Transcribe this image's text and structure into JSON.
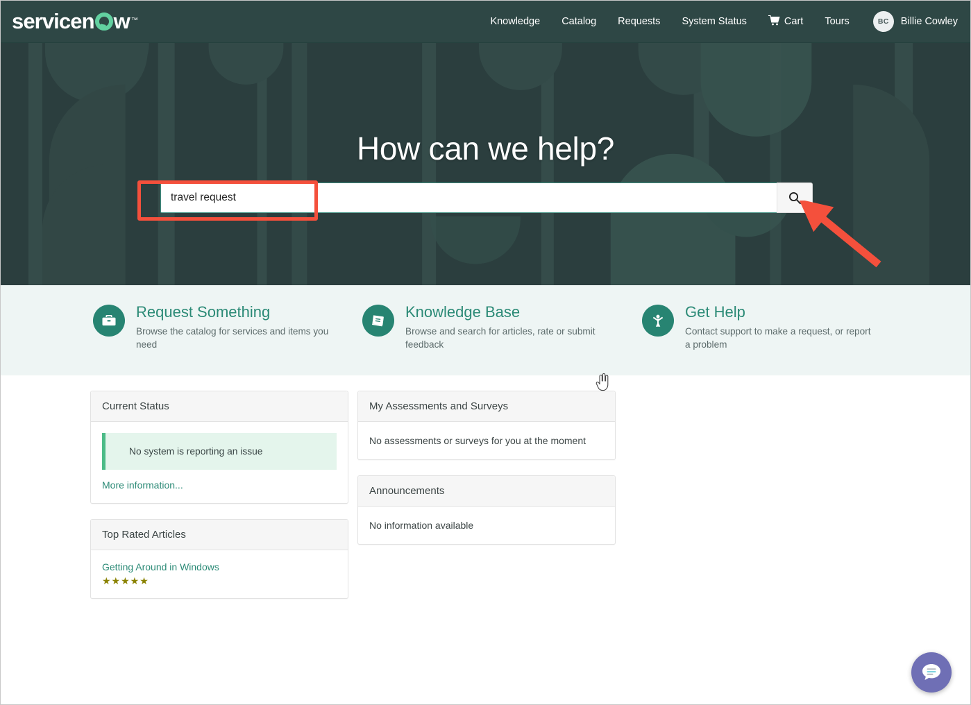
{
  "header": {
    "logo_text_1": "servicen",
    "logo_text_2": "w",
    "logo_tm": "™",
    "nav": [
      {
        "label": "Knowledge"
      },
      {
        "label": "Catalog"
      },
      {
        "label": "Requests"
      },
      {
        "label": "System Status"
      },
      {
        "label": "Cart",
        "icon": "cart-icon"
      },
      {
        "label": "Tours"
      }
    ],
    "user": {
      "initials": "BC",
      "name": "Billie Cowley"
    }
  },
  "hero": {
    "title": "How can we help?",
    "search": {
      "value": "travel request",
      "placeholder": "",
      "button_icon": "search-icon"
    }
  },
  "quicklinks": [
    {
      "icon": "briefcase-icon",
      "title": "Request Something",
      "desc": "Browse the catalog for services and items you need"
    },
    {
      "icon": "book-icon",
      "title": "Knowledge Base",
      "desc": "Browse and search for articles, rate or submit feedback"
    },
    {
      "icon": "person-help-icon",
      "title": "Get Help",
      "desc": "Contact support to make a request, or report a problem"
    }
  ],
  "cards": {
    "current_status": {
      "title": "Current Status",
      "alert_text": "No system is reporting an issue",
      "link": "More information..."
    },
    "top_rated": {
      "title": "Top Rated Articles",
      "article": "Getting Around in Windows",
      "stars": "★★★★★"
    },
    "assessments": {
      "title": "My Assessments and Surveys",
      "empty": "No assessments or surveys for you at the moment"
    },
    "announcements": {
      "title": "Announcements",
      "empty": "No information available"
    }
  },
  "chat": {
    "icon": "chat-bubble-icon"
  },
  "colors": {
    "header_bg": "#2e4745",
    "hero_bg": "#2b3e3e",
    "accent_teal": "#2b8a76",
    "icon_circle": "#278472",
    "band_bg": "#eef5f4",
    "annotation_red": "#f4503c",
    "status_green": "#4cbb87",
    "star_gold": "#8a8200",
    "chat_purple": "#6f6fb5",
    "logo_green": "#62d0a0"
  }
}
